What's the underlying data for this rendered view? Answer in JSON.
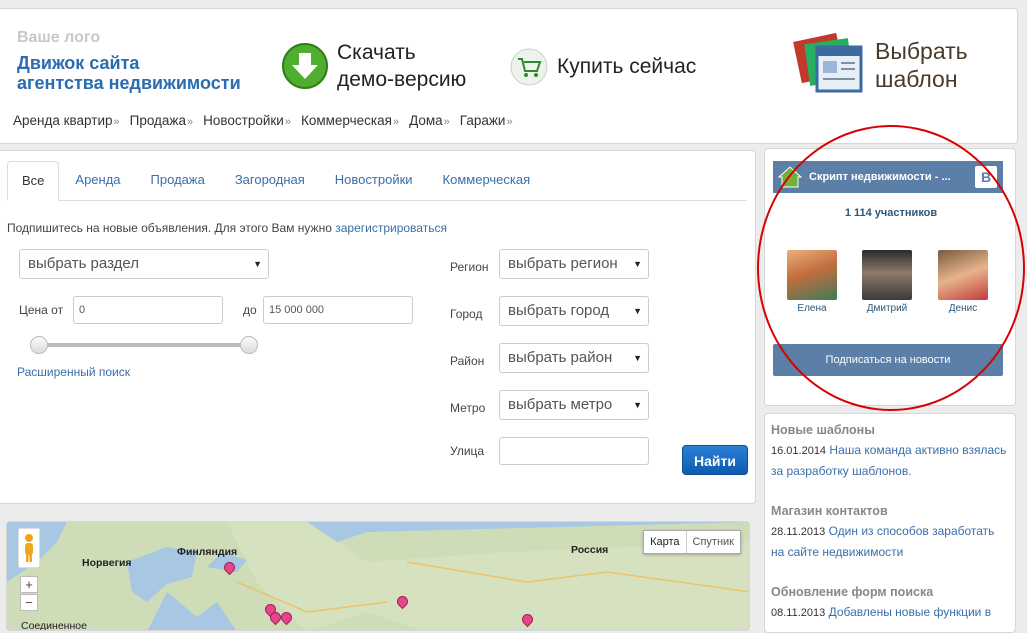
{
  "header": {
    "logo_small": "Ваше лого",
    "logo_title_line1": "Движок сайта",
    "logo_title_line2": "агентства недвижимости",
    "download_line1": "Скачать",
    "download_line2": "демо-версию",
    "buy": "Купить сейчас",
    "template_line1": "Выбрать",
    "template_line2": "шаблон",
    "nav": [
      "Аренда квартир",
      "Продажа",
      "Новостройки",
      "Коммерческая",
      "Дома",
      "Гаражи"
    ],
    "nav_marker": "»"
  },
  "search": {
    "tabs": [
      "Все",
      "Аренда",
      "Продажа",
      "Загородная",
      "Новостройки",
      "Коммерческая"
    ],
    "active_tab": "Все",
    "subscribe_text": "Подпишитесь на новые объявления. Для этого Вам нужно ",
    "subscribe_link": "зарегистрироваться",
    "section_select": "выбрать раздел",
    "price_from_label": "Цена от",
    "price_from_value": "0",
    "price_to_label": "до",
    "price_to_value": "15 000 000",
    "advanced_link": "Расширенный поиск",
    "region_label": "Регион",
    "region_select": "выбрать регион",
    "city_label": "Город",
    "city_select": "выбрать город",
    "district_label": "Район",
    "district_select": "выбрать район",
    "metro_label": "Метро",
    "metro_select": "выбрать метро",
    "street_label": "Улица",
    "street_value": "",
    "find_button": "Найти",
    "select_arrow": "▼"
  },
  "map": {
    "btn_map": "Карта",
    "btn_satellite": "Спутник",
    "zoom_in": "+",
    "zoom_out": "−",
    "labels": [
      "Норвегия",
      "Финляндия",
      "Россия",
      "Соединенное"
    ]
  },
  "vk_widget": {
    "title": "Скрипт недвижимости - ...",
    "logo_letter": "В",
    "members": "1 114 участников",
    "members_list": [
      "Елена",
      "Дмитрий",
      "Денис"
    ],
    "subscribe_button": "Подписаться на новости"
  },
  "news": [
    {
      "title": "Новые шаблоны",
      "date": "16.01.2014",
      "text": "Наша команда активно взялась за разработку шаблонов."
    },
    {
      "title": "Магазин контактов",
      "date": "28.11.2013",
      "text": "Один из способов заработать на сайте недвижимости"
    },
    {
      "title": "Обновление форм поиска",
      "date": "08.11.2013",
      "text": "Добавлены новые функции в"
    }
  ],
  "colors": {
    "accent": "#2b6cb0",
    "vk_blue": "#5b7fa6",
    "button_blue": "#1a6cc4",
    "annotation_red": "#d90000"
  }
}
